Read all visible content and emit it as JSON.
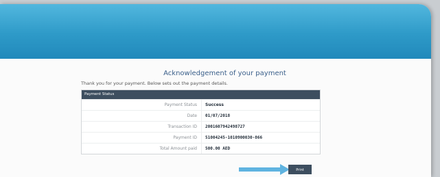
{
  "page": {
    "title": "Acknowledgement of your payment",
    "intro": "Thank you for your payment. Below sets out the payment details."
  },
  "panel": {
    "header": "Payment Status",
    "rows": [
      {
        "label": "Payment Status",
        "value": "Success"
      },
      {
        "label": "Date",
        "value": "01/07/2018"
      },
      {
        "label": "Transaction ID",
        "value": "2001607942498727"
      },
      {
        "label": "Payment ID",
        "value": "51004245-1010900030-866"
      },
      {
        "label": "Total Amount paid",
        "value": "500.00 AED"
      }
    ]
  },
  "actions": {
    "print_label": "Print"
  },
  "colors": {
    "header_band": "#2e9ac8",
    "panel_header": "#3d4e5f",
    "arrow": "#5fb3e0"
  }
}
